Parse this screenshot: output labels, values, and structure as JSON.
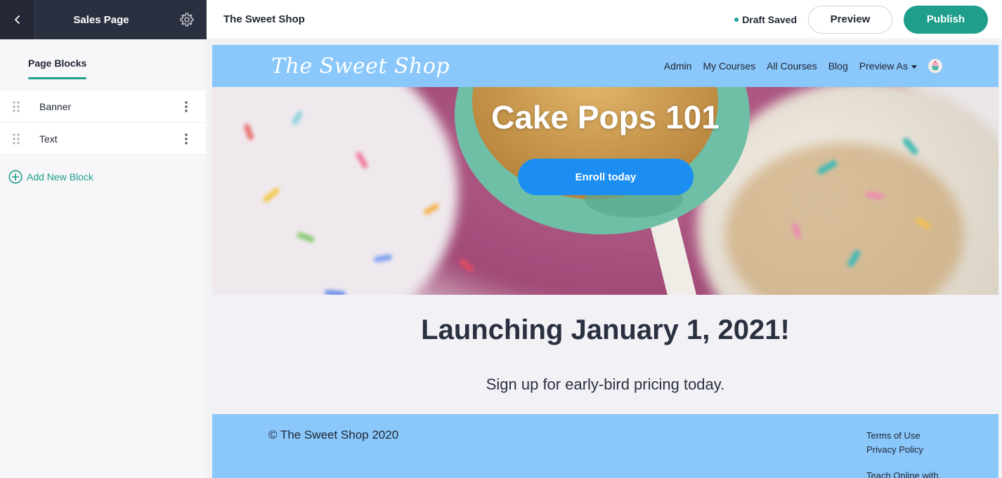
{
  "editor": {
    "sidebar_title": "Sales Page",
    "site_name": "The Sweet Shop",
    "draft_status": "Draft Saved",
    "preview_label": "Preview",
    "publish_label": "Publish",
    "accent_color": "#1f9e8c"
  },
  "sidebar": {
    "tab": "Page Blocks",
    "blocks": [
      {
        "label": "Banner"
      },
      {
        "label": "Text"
      }
    ],
    "add_block_label": "Add New Block"
  },
  "site": {
    "logo": "The Sweet Shop",
    "nav": {
      "admin": "Admin",
      "my_courses": "My Courses",
      "all_courses": "All Courses",
      "blog": "Blog",
      "preview_as": "Preview As"
    },
    "banner": {
      "title": "Cake Pops 101",
      "button_label": "Enroll today"
    },
    "text_block": {
      "heading": "Launching January 1, 2021!",
      "subheading": "Sign up for early-bird pricing today."
    },
    "footer": {
      "copyright": "© The Sweet Shop 2020",
      "terms": "Terms of Use",
      "privacy": "Privacy Policy",
      "partial": "Teach Online with"
    },
    "header_color": "#8ac7fb",
    "button_color": "#1c8ef2"
  }
}
